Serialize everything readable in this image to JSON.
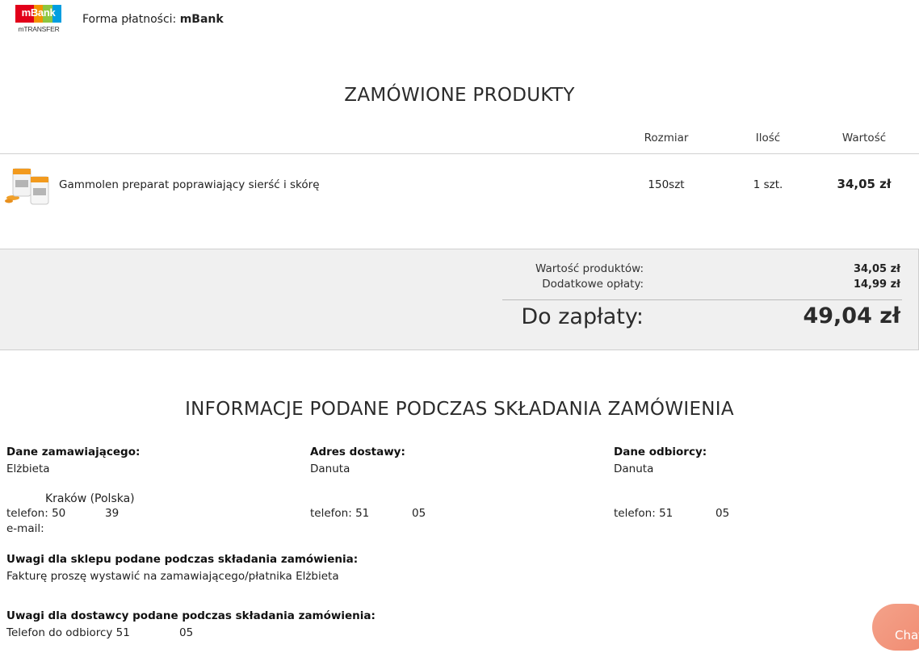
{
  "header": {
    "logo_text": "mBank",
    "logo_sub": "mTRANSFER",
    "logo_colors": [
      "#e2001a",
      "#f39200",
      "#8dc63f",
      "#009ee0",
      "#e2001a"
    ],
    "payment_label": "Forma płatności:",
    "payment_value": "mBank"
  },
  "products": {
    "title": "ZAMÓWIONE PRODUKTY",
    "columns": {
      "size": "Rozmiar",
      "qty": "Ilość",
      "value": "Wartość"
    },
    "items": [
      {
        "name": "Gammolen preparat poprawiający sierść i skórę",
        "size": "150szt",
        "qty": "1 szt.",
        "value": "34,05 zł"
      }
    ]
  },
  "summary": {
    "products_label": "Wartość produktów:",
    "products_value": "34,05 zł",
    "fees_label": "Dodatkowe opłaty:",
    "fees_value": "14,99 zł",
    "total_label": "Do zapłaty:",
    "total_value": "49,04 zł"
  },
  "info": {
    "title": "INFORMACJE PODANE PODCZAS SKŁADANIA ZAMÓWIENIA",
    "orderer": {
      "heading": "Dane zamawiającego:",
      "name": "Elżbieta",
      "city": "Kraków (Polska)",
      "phone": "telefon: 50",
      "phone_end": "39",
      "email": "e-mail:"
    },
    "delivery": {
      "heading": "Adres dostawy:",
      "name": "Danuta",
      "phone": "telefon: 51",
      "phone_end": "05"
    },
    "recipient": {
      "heading": "Dane odbiorcy:",
      "name": "Danuta",
      "phone": "telefon: 51",
      "phone_end": "05"
    },
    "shop_notes_heading": "Uwagi dla sklepu podane podczas składania zamówienia:",
    "shop_notes": "Fakturę proszę wystawić na zamawiającego/płatnika Elżbieta",
    "courier_notes_heading": "Uwagi dla dostawcy podane podczas składania zamówienia:",
    "courier_notes": "Telefon do odbiorcy 51",
    "courier_notes_end": "05"
  },
  "chat": {
    "label": "Chat",
    "color": "#f29479"
  }
}
